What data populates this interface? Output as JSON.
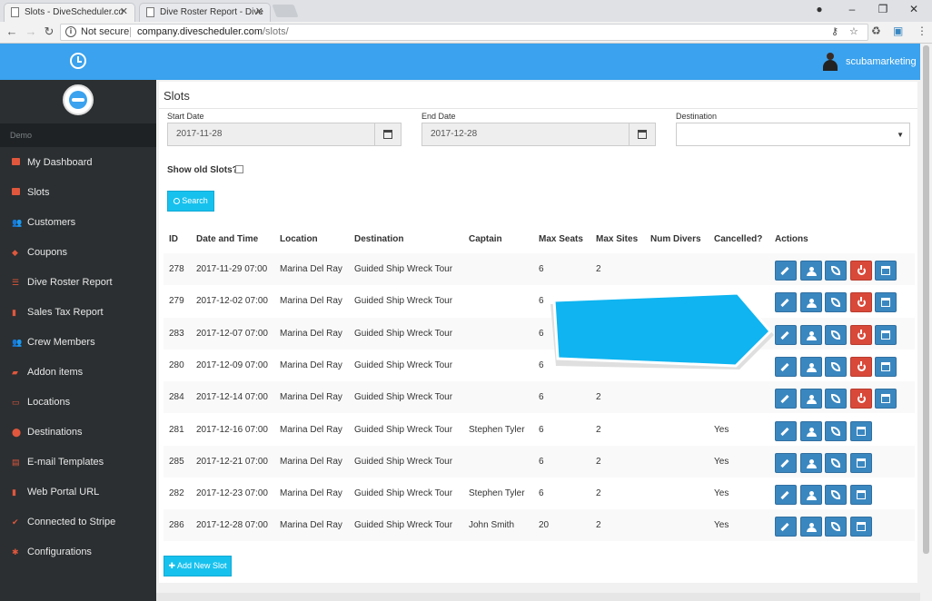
{
  "browser": {
    "tabs": [
      {
        "title": "Slots - DiveScheduler.co",
        "active": true
      },
      {
        "title": "Dive Roster Report - Dive",
        "active": false
      }
    ],
    "security": "Not secure",
    "url_host": "company.divescheduler.com",
    "url_path": "/slots/"
  },
  "header": {
    "username": "scubamarketing"
  },
  "sidebar": {
    "org": "Demo",
    "items": [
      {
        "label": "My Dashboard",
        "icon": "sitemap-icon"
      },
      {
        "label": "Slots",
        "icon": "sitemap-icon"
      },
      {
        "label": "Customers",
        "icon": "users-icon"
      },
      {
        "label": "Coupons",
        "icon": "tag-icon"
      },
      {
        "label": "Dive Roster Report",
        "icon": "list-icon"
      },
      {
        "label": "Sales Tax Report",
        "icon": "book-icon"
      },
      {
        "label": "Crew Members",
        "icon": "users-icon"
      },
      {
        "label": "Addon items",
        "icon": "briefcase-icon"
      },
      {
        "label": "Locations",
        "icon": "map-icon"
      },
      {
        "label": "Destinations",
        "icon": "map-marker-icon"
      },
      {
        "label": "E-mail Templates",
        "icon": "file-icon"
      },
      {
        "label": "Web Portal URL",
        "icon": "bookmark-icon"
      },
      {
        "label": "Connected to Stripe",
        "icon": "check-icon"
      },
      {
        "label": "Configurations",
        "icon": "gear-icon"
      }
    ]
  },
  "page": {
    "title": "Slots",
    "start_label": "Start Date",
    "start_value": "2017-11-28",
    "end_label": "End Date",
    "end_value": "2017-12-28",
    "dest_label": "Destination",
    "dest_value": "",
    "show_old_label": "Show old Slots?",
    "search_label": "Search",
    "add_label": "Add New Slot"
  },
  "table": {
    "columns": [
      "ID",
      "Date and Time",
      "Location",
      "Destination",
      "Captain",
      "Max Seats",
      "Max Sites",
      "Num Divers",
      "Cancelled?",
      "Actions"
    ],
    "rows": [
      {
        "id": "278",
        "date": "2017-11-29 07:00",
        "location": "Marina Del Ray",
        "destination": "Guided Ship Wreck Tour",
        "captain": "",
        "seats": "6",
        "sites": "2",
        "divers": "",
        "cancelled": "",
        "power": true
      },
      {
        "id": "279",
        "date": "2017-12-02 07:00",
        "location": "Marina Del Ray",
        "destination": "Guided Ship Wreck Tour",
        "captain": "",
        "seats": "6",
        "sites": "",
        "divers": "",
        "cancelled": "",
        "power": true
      },
      {
        "id": "283",
        "date": "2017-12-07 07:00",
        "location": "Marina Del Ray",
        "destination": "Guided Ship Wreck Tour",
        "captain": "",
        "seats": "6",
        "sites": "",
        "divers": "",
        "cancelled": "",
        "power": true
      },
      {
        "id": "280",
        "date": "2017-12-09 07:00",
        "location": "Marina Del Ray",
        "destination": "Guided Ship Wreck Tour",
        "captain": "",
        "seats": "6",
        "sites": "",
        "divers": "",
        "cancelled": "",
        "power": true
      },
      {
        "id": "284",
        "date": "2017-12-14 07:00",
        "location": "Marina Del Ray",
        "destination": "Guided Ship Wreck Tour",
        "captain": "",
        "seats": "6",
        "sites": "2",
        "divers": "",
        "cancelled": "",
        "power": true
      },
      {
        "id": "281",
        "date": "2017-12-16 07:00",
        "location": "Marina Del Ray",
        "destination": "Guided Ship Wreck Tour",
        "captain": "Stephen Tyler",
        "seats": "6",
        "sites": "2",
        "divers": "",
        "cancelled": "Yes",
        "power": false
      },
      {
        "id": "285",
        "date": "2017-12-21 07:00",
        "location": "Marina Del Ray",
        "destination": "Guided Ship Wreck Tour",
        "captain": "",
        "seats": "6",
        "sites": "2",
        "divers": "",
        "cancelled": "Yes",
        "power": false
      },
      {
        "id": "282",
        "date": "2017-12-23 07:00",
        "location": "Marina Del Ray",
        "destination": "Guided Ship Wreck Tour",
        "captain": "Stephen Tyler",
        "seats": "6",
        "sites": "2",
        "divers": "",
        "cancelled": "Yes",
        "power": false
      },
      {
        "id": "286",
        "date": "2017-12-28 07:00",
        "location": "Marina Del Ray",
        "destination": "Guided Ship Wreck Tour",
        "captain": "John Smith",
        "seats": "20",
        "sites": "2",
        "divers": "",
        "cancelled": "Yes",
        "power": false
      }
    ]
  },
  "colors": {
    "topbar": "#3aa2ee",
    "sidebar": "#2b2f31",
    "accent_icon": "#e0573d",
    "action_blue": "#3a87c0",
    "action_red": "#d9493a",
    "search_button": "#17c1ee",
    "overlay_arrow": "#0fb4f0"
  }
}
